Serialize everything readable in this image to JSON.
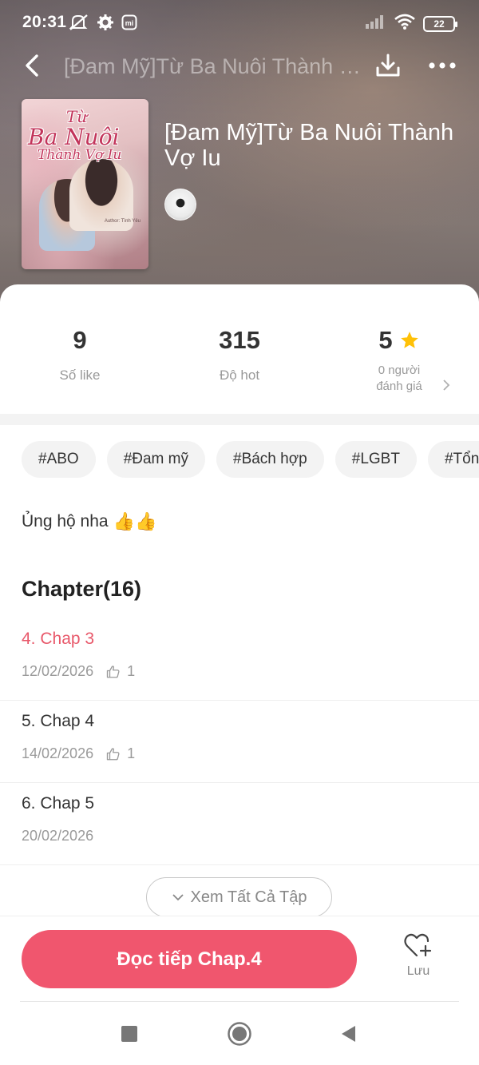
{
  "status_bar": {
    "time": "20:31",
    "battery": "22"
  },
  "nav": {
    "title": "[Đam Mỹ]Từ Ba Nuôi Thành Vợ Iu"
  },
  "book": {
    "title": "[Đam Mỹ]Từ Ba Nuôi Thành Vợ Iu",
    "cover": {
      "title_line1": "Từ",
      "title_line2": "Ba Nuôi",
      "title_line3": "Thành Vợ Iu",
      "author_text": "Author: Tình Yêu"
    }
  },
  "stats": [
    {
      "value": "9",
      "label": "Số like"
    },
    {
      "value": "315",
      "label": "Độ hot"
    },
    {
      "value": "5",
      "label_line1": "0 người",
      "label_line2": "đánh giá"
    }
  ],
  "tags": [
    "#ABO",
    "#Đam mỹ",
    "#Bách hợp",
    "#LGBT",
    "#Tổng"
  ],
  "description": {
    "text": "Ủng hộ nha",
    "emoji": "👍👍"
  },
  "chapters": {
    "heading": "Chapter(16)",
    "items": [
      {
        "title": "4. Chap 3",
        "date": "12/02/2026",
        "likes": "1",
        "active": true
      },
      {
        "title": "5. Chap 4",
        "date": "14/02/2026",
        "likes": "1",
        "active": false
      },
      {
        "title": "6. Chap 5",
        "date": "20/02/2026",
        "likes": "",
        "active": false
      }
    ],
    "see_all": "Xem Tất Cả Tập"
  },
  "actions": {
    "read_button": "Đọc tiếp Chap.4",
    "save_label": "Lưu"
  },
  "colors": {
    "accent": "#f0566e",
    "active_chapter": "#e8586a",
    "star": "#ffc107"
  }
}
